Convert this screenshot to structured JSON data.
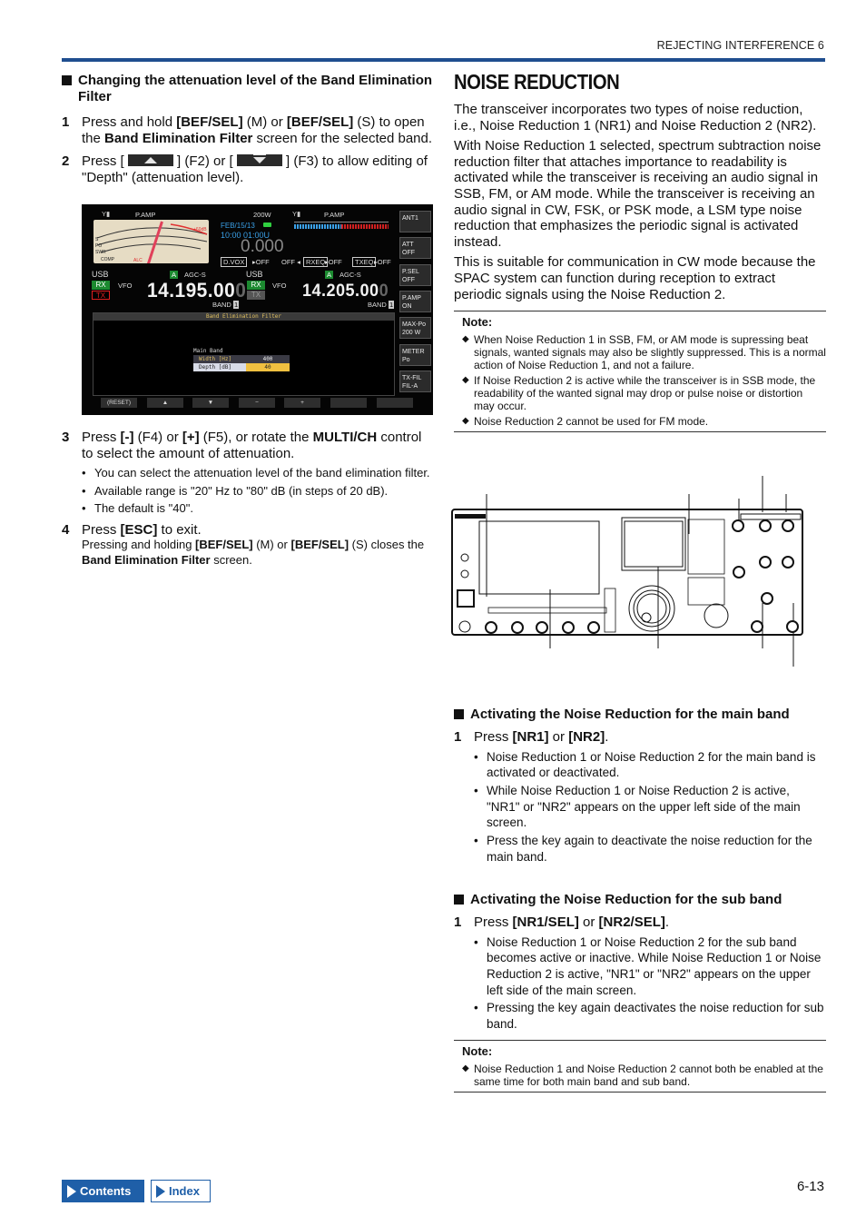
{
  "header": {
    "section": "REJECTING INTERFERENCE 6"
  },
  "left": {
    "heading": "Changing the attenuation level of the Band Elimination Filter",
    "step1": {
      "num": "1",
      "t1": "Press and hold ",
      "b1": "[BEF/SEL]",
      "t2": " (M) or ",
      "b2": "[BEF/SEL]",
      "t3": " (S) to open the ",
      "b3": "Band Elimination Filter",
      "t4": " screen for the selected band."
    },
    "step2": {
      "num": "2",
      "t1": "Press [",
      "t2": "] (F2) or [",
      "t3": "] (F3) to allow editing of \"Depth\" (attenuation level)."
    },
    "step3": {
      "num": "3",
      "t1": "Press ",
      "b1": "[-]",
      "t2": " (F4) or ",
      "b2": "[+]",
      "t3": " (F5), or rotate the ",
      "b3": "MULTI/CH",
      "t4": " control to select the amount of attenuation.",
      "bullets": [
        "You can select the attenuation level of the band elimination filter.",
        "Available range is \"20\" Hz to \"80\" dB (in steps of 20 dB).",
        "The default is \"40\"."
      ]
    },
    "step4": {
      "num": "4",
      "t1": "Press ",
      "b1": "[ESC]",
      "t2": " to exit.",
      "s1": "Pressing and holding ",
      "sb1": "[BEF/SEL]",
      "s2": " (M) or ",
      "sb2": "[BEF/SEL]",
      "s3": " (S) closes the ",
      "sb3": "Band Elimination Filter",
      "s4": " screen."
    }
  },
  "screen": {
    "main_pamp": "P.AMP",
    "sub_pamp": "P.AMP",
    "power": "200W",
    "date": "FEB/15/13",
    "time": "10:00 01:00U",
    "small_freq": "0.000",
    "dvox": "D.VOX",
    "dvox_val": "OFF",
    "off_left": "OFF",
    "rxeq": "RXEQ",
    "rxeq_val": "OFF",
    "txeq": "TXEQ",
    "txeq_val": "OFF",
    "main_mode": "USB",
    "sub_mode": "USB",
    "agc_main": "AGC-S",
    "agc_sub": "AGC-S",
    "vfo_main": "VFO",
    "vfo_sub": "VFO",
    "rx": "RX",
    "tx": "TX",
    "main_freq": "14.195.00",
    "main_freq_last": "0",
    "sub_freq": "14.205.00",
    "sub_freq_last": "0",
    "band_label": "BAND",
    "band_num": "1",
    "side_buttons": [
      {
        "l1": "ANT1",
        "l2": ""
      },
      {
        "l1": "ATT",
        "l2": "OFF"
      },
      {
        "l1": "P.SEL",
        "l2": "OFF"
      },
      {
        "l1": "P.AMP",
        "l2": "ON"
      },
      {
        "l1": "MAX-Po",
        "l2": "200 W"
      },
      {
        "l1": "METER",
        "l2": "Po"
      },
      {
        "l1": "TX-FIL",
        "l2": "FIL-A"
      }
    ],
    "bef": {
      "title": "Band Elimination Filter",
      "band": "Main Band",
      "width_label": "Width [Hz]",
      "width_value": "400",
      "depth_label": "Depth [dB]",
      "depth_value": "40"
    },
    "fkeys": [
      "(RESET)",
      "▲",
      "▼",
      "−",
      "+",
      "",
      ""
    ]
  },
  "right": {
    "title": "NOISE REDUCTION",
    "paras": [
      "The transceiver incorporates two types of noise reduction, i.e., Noise Reduction 1 (NR1) and Noise Reduction 2 (NR2).",
      "With Noise Reduction 1 selected, spectrum subtraction noise reduction filter that attaches importance to readability is activated while the transceiver is receiving an audio signal in SSB, FM, or AM mode. While the transceiver is receiving an audio signal in CW, FSK, or PSK mode, a LSM type noise reduction that emphasizes the periodic signal is activated instead.",
      "This is suitable for communication in CW mode because the SPAC system can function during reception to extract periodic signals using the Noise Reduction 2."
    ],
    "note1": {
      "title": "Note:",
      "items": [
        "When Noise Reduction 1 in SSB, FM, or AM mode is supressing beat signals, wanted signals may also be slightly suppressed. This is a normal action of Noise Reduction 1, and not a failure.",
        "If Noise Reduction 2 is active while the transceiver is in SSB mode, the readability of the wanted signal may drop or pulse noise or distortion may occur.",
        "Noise Reduction 2 cannot be used for FM mode."
      ]
    },
    "main_band": {
      "heading": "Activating the Noise Reduction for the main band",
      "num": "1",
      "t1": "Press ",
      "b1": "[NR1]",
      "t2": " or ",
      "b2": "[NR2]",
      "t3": ".",
      "bullets": [
        "Noise Reduction 1 or Noise Reduction 2 for the main band is activated or deactivated.",
        "While Noise Reduction 1 or Noise Reduction 2 is active, \"NR1\" or \"NR2\" appears on the upper left side of the main screen.",
        "Press the key again to deactivate the noise reduction for the main band."
      ]
    },
    "sub_band": {
      "heading": "Activating the Noise Reduction for the sub band",
      "num": "1",
      "t1": "Press ",
      "b1": "[NR1/SEL]",
      "t2": " or ",
      "b2": "[NR2/SEL]",
      "t3": ".",
      "bullets": [
        "Noise Reduction 1 or Noise Reduction 2 for the sub band becomes active or inactive. While Noise Reduction 1 or Noise Reduction 2 is active, \"NR1\" or \"NR2\" appears on the upper left side of the main screen.",
        "Pressing the key again deactivates the noise reduction for sub band."
      ]
    },
    "note2": {
      "title": "Note:",
      "items": [
        "Noise Reduction 1 and Noise Reduction 2 cannot both be enabled at the same time for both main band and sub band."
      ]
    }
  },
  "footer": {
    "contents": "Contents",
    "index": "Index",
    "page": "6-13"
  },
  "colors": {
    "accent": "#1f4e8f",
    "button": "#1f5fa8"
  }
}
